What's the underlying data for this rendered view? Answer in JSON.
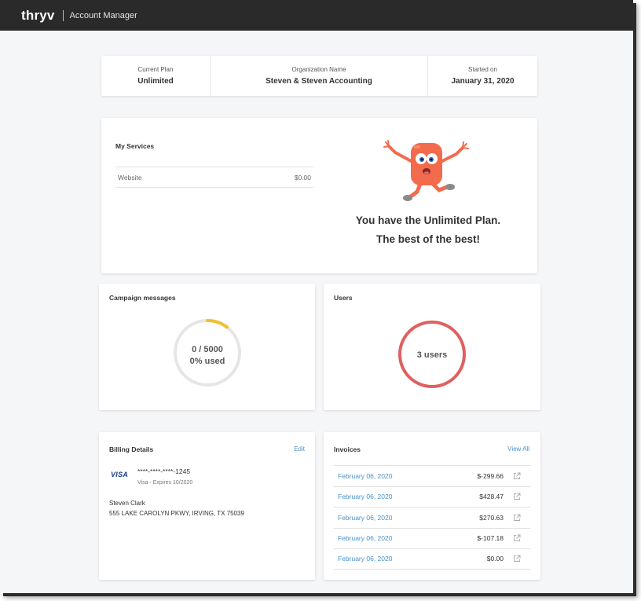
{
  "header": {
    "logo": "thryv",
    "app_title": "Account Manager"
  },
  "summary": {
    "current_plan_label": "Current Plan",
    "current_plan_value": "Unlimited",
    "org_label": "Organization Name",
    "org_value": "Steven & Steven Accounting",
    "started_label": "Started on",
    "started_value": "January 31, 2020"
  },
  "services": {
    "title": "My Services",
    "items": [
      {
        "name": "Website",
        "price": "$0.00"
      }
    ],
    "plan_message_line1": "You have the Unlimited Plan.",
    "plan_message_line2": "The best of the best!"
  },
  "campaign": {
    "title": "Campaign messages",
    "count_text": "0 / 5000",
    "used_text": "0% used",
    "ring_color": "#f0c030",
    "track_color": "#e6e6e6"
  },
  "users": {
    "title": "Users",
    "count_text": "3 users",
    "ring_color": "#e06060"
  },
  "billing": {
    "title": "Billing Details",
    "edit_label": "Edit",
    "card_brand": "VISA",
    "card_number": "****-****-****-1245",
    "card_expiry": "Visa - Expires 10/2020",
    "name": "Steven Clark",
    "address": "555 LAKE CAROLYN PKWY, IRVING, TX 75039"
  },
  "invoices": {
    "title": "Invoices",
    "view_all_label": "View All",
    "rows": [
      {
        "date": "February 06, 2020",
        "amount": "$-299.66"
      },
      {
        "date": "February 06, 2020",
        "amount": "$428.47"
      },
      {
        "date": "February 06, 2020",
        "amount": "$270.63"
      },
      {
        "date": "February 06, 2020",
        "amount": "$-107.18"
      },
      {
        "date": "February 06, 2020",
        "amount": "$0.00"
      }
    ]
  },
  "colors": {
    "link": "#4a90c8",
    "topbar": "#2a2a2a",
    "mascot": "#f26b4c"
  }
}
